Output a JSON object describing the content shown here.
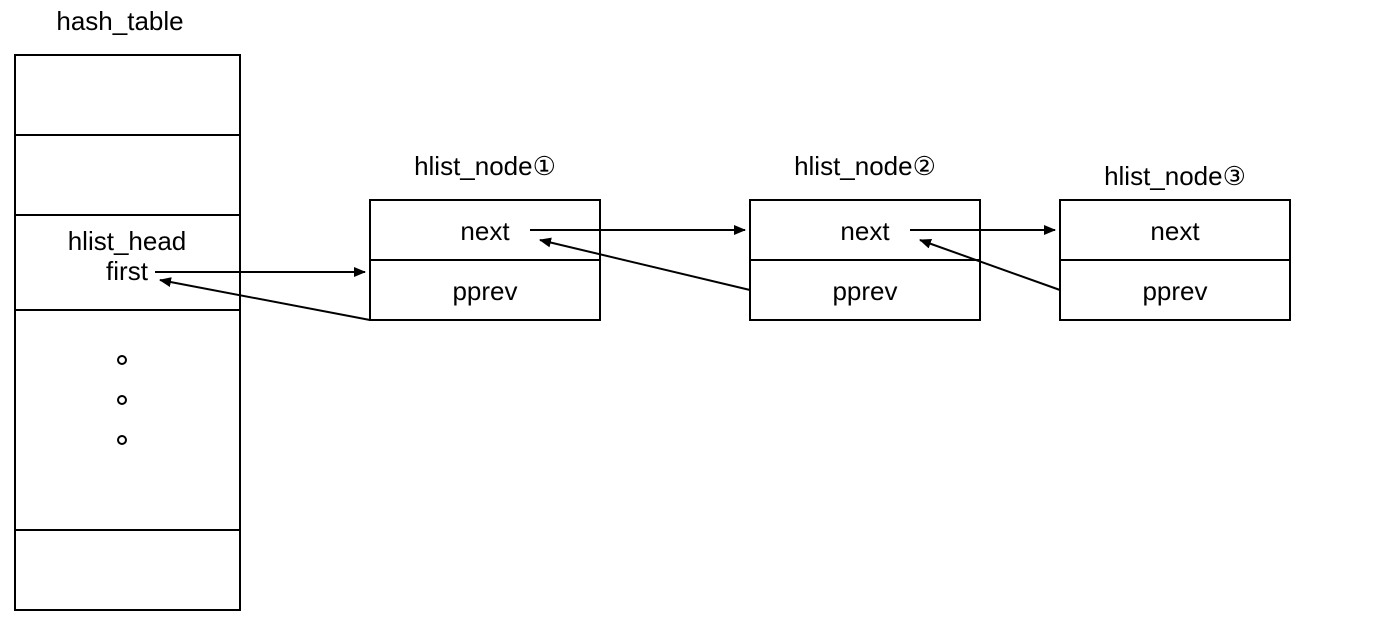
{
  "title": "hash_table",
  "head": {
    "label_top": "hlist_head",
    "label_bottom": "first"
  },
  "nodes": [
    {
      "title": "hlist_node①",
      "next": "next",
      "pprev": "pprev"
    },
    {
      "title": "hlist_node②",
      "next": "next",
      "pprev": "pprev"
    },
    {
      "title": "hlist_node③",
      "next": "next",
      "pprev": "pprev"
    }
  ]
}
